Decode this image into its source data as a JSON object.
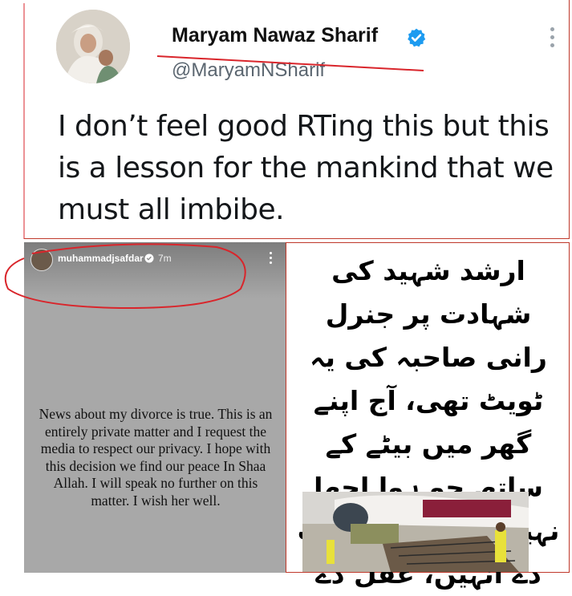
{
  "tweet": {
    "display_name": "Maryam Nawaz Sharif",
    "handle": "@MaryamNSharif",
    "text": "I don’t feel good RTing this but this is a lesson for the mankind that we must all imbibe.",
    "verified_icon": "verified-badge-icon",
    "more_icon": "more-vertical-icon"
  },
  "story": {
    "username": "muhammadjsafdar",
    "time": "7m",
    "text": "News about my divorce is true. This is an entirely private matter and I request the media to respect our privacy. I hope with this decision we find our peace In Shaa Allah. I will speak no further on this matter. I wish her well."
  },
  "urdu": {
    "text": "ارشد شہید کی شہادت پر جنرل رانی صاحبہ کی یہ ٹویٹ تھی، آج اپنے گھر میں بیٹے کے ساتھ جو ہوا اچھا نہیں ہوا، اللہ ہدایت دے انہیں، عقل دے"
  },
  "colors": {
    "annotation_red": "#d9252b",
    "verified_blue": "#1d9bf0",
    "story_bg": "#a8a8a8"
  }
}
